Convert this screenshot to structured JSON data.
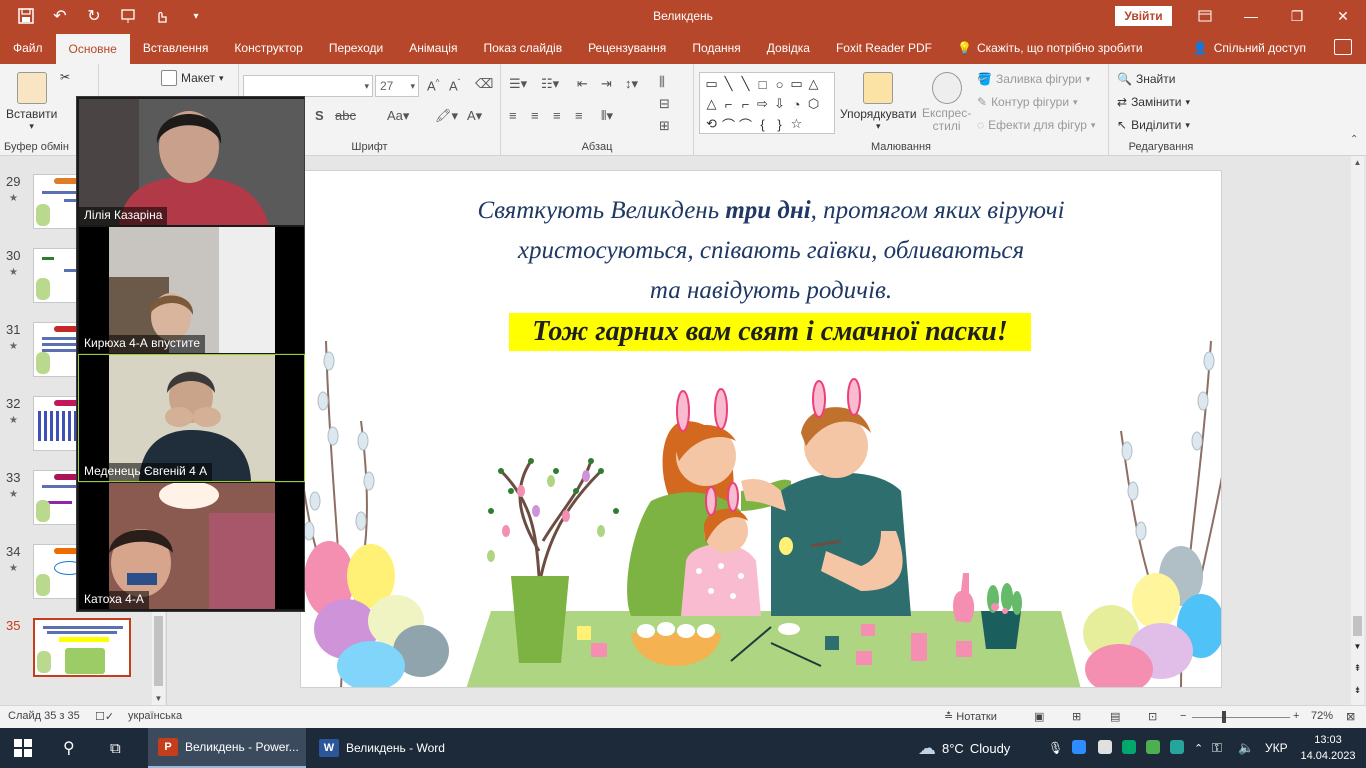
{
  "window": {
    "title": "Великдень",
    "signin_label": "Увійти",
    "minimize_glyph": "—",
    "restore_glyph": "❐",
    "close_glyph": "✕"
  },
  "qat": {
    "save_icon": "save-icon",
    "undo_icon": "undo-icon",
    "redo_icon": "redo-icon",
    "present_icon": "present-icon",
    "touch_icon": "touch-mode-icon",
    "more_icon": "more-icon"
  },
  "tabs": [
    {
      "label": "Файл"
    },
    {
      "label": "Основне"
    },
    {
      "label": "Вставлення"
    },
    {
      "label": "Конструктор"
    },
    {
      "label": "Переходи"
    },
    {
      "label": "Анімація"
    },
    {
      "label": "Показ слайдів"
    },
    {
      "label": "Рецензування"
    },
    {
      "label": "Подання"
    },
    {
      "label": "Довідка"
    },
    {
      "label": "Foxit Reader PDF"
    }
  ],
  "tell_me": "Скажіть, що потрібно зробити",
  "share_label": "Спільний доступ",
  "ribbon": {
    "paste_label": "Вставити",
    "clipboard_label": "Буфер обмін",
    "layout_label": "Макет",
    "font_label": "Шрифт",
    "font_size_value": "27",
    "paragraph_label": "Абзац",
    "drawing_label": "Малювання",
    "arrange_label": "Упорядкувати",
    "quick_styles_label": "Експрес-\nстилі",
    "shape_fill_label": "Заливка фігури",
    "shape_outline_label": "Контур фігури",
    "shape_effects_label": "Ефекти для фігур",
    "find_label": "Знайти",
    "replace_label": "Замінити",
    "select_label": "Виділити",
    "editing_label": "Редагування"
  },
  "thumbnails": [
    {
      "num": "29",
      "star": "★"
    },
    {
      "num": "30",
      "star": "★"
    },
    {
      "num": "31",
      "star": "★"
    },
    {
      "num": "32",
      "star": "★"
    },
    {
      "num": "33",
      "star": "★"
    },
    {
      "num": "34",
      "star": "★"
    },
    {
      "num": "35",
      "star": ""
    }
  ],
  "slide": {
    "line1_a": "Святкують Великдень ",
    "line1_b": "три дні",
    "line1_c": ", протягом яких віруючі",
    "line2": "христосуються, співають гаївки, обливаються",
    "line3": "та навідують родичів.",
    "highlight": "Тож гарних вам свят і смачної паски!"
  },
  "zoom": {
    "participants": [
      {
        "name": "Лілія Казаріна"
      },
      {
        "name": "Кирюха 4-А впустите"
      },
      {
        "name": "Меденець Євгеній 4 А"
      },
      {
        "name": "Катоха 4-А"
      }
    ]
  },
  "status": {
    "slide_counter": "Слайд 35 з 35",
    "language": "українська",
    "notes_label": "Нотатки",
    "zoom_level": "72%",
    "zoom_minus": "−",
    "zoom_plus": "+"
  },
  "taskbar": {
    "apps": [
      {
        "label": "Великдень - Power...",
        "icon": "P"
      },
      {
        "label": "Великдень - Word",
        "icon": "W"
      }
    ],
    "weather_temp": "8°C",
    "weather_desc": "Cloudy",
    "input_lang": "УКР",
    "time": "13:03",
    "date": "14.04.2023"
  },
  "colors": {
    "accent": "#b7472a",
    "slide_text": "#1f3864",
    "highlight": "#ffff00"
  }
}
